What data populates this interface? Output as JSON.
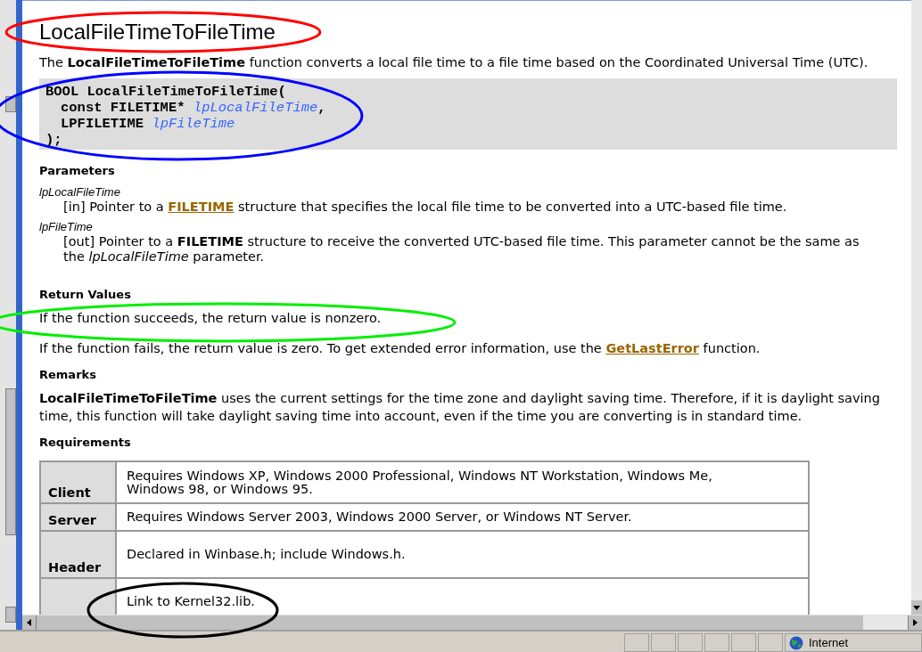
{
  "title": "LocalFileTimeToFileTime",
  "intro": "The **LocalFileTimeToFileTime** function converts a local file time to a file time based on the Coordinated Universal Time (UTC).",
  "syntax": [
    {
      "indent": false,
      "parts": [
        {
          "kind": "type",
          "text": "BOOL LocalFileTimeToFileTime("
        }
      ]
    },
    {
      "indent": true,
      "parts": [
        {
          "kind": "type",
          "text": "const FILETIME* "
        },
        {
          "kind": "param",
          "text": "lpLocalFileTime"
        },
        {
          "kind": "type",
          "text": ","
        }
      ]
    },
    {
      "indent": true,
      "parts": [
        {
          "kind": "type",
          "text": "LPFILETIME "
        },
        {
          "kind": "param",
          "text": "lpFileTime"
        }
      ]
    },
    {
      "indent": false,
      "parts": [
        {
          "kind": "type",
          "text": ");"
        }
      ]
    }
  ],
  "sections": [
    {
      "heading": "Parameters",
      "kind": "params",
      "items": [
        {
          "name": "lpLocalFileTime",
          "description": [
            {
              "kind": "text",
              "text": "[in] Pointer to a "
            },
            {
              "kind": "link",
              "text": "FILETIME"
            },
            {
              "kind": "text",
              "text": " structure that specifies the local file time to be converted into a UTC-based file time."
            }
          ]
        },
        {
          "name": "lpFileTime",
          "description": [
            {
              "kind": "text",
              "text": "[out] Pointer to a **FILETIME** structure to receive the converted UTC-based file time. This parameter cannot be the same as the *lpLocalFileTime* parameter."
            }
          ]
        }
      ]
    },
    {
      "heading": "Return Values",
      "kind": "paragraphs",
      "items": [
        [
          {
            "kind": "text",
            "text": "If the function succeeds, the return value is nonzero."
          }
        ],
        [
          {
            "kind": "text",
            "text": "If the function fails, the return value is zero. To get extended error information, use the "
          },
          {
            "kind": "link",
            "text": "GetLastError"
          },
          {
            "kind": "text",
            "text": " function."
          }
        ]
      ]
    },
    {
      "heading": "Remarks",
      "kind": "paragraphs",
      "items": [
        [
          {
            "kind": "text",
            "text": "**LocalFileTimeToFileTime** uses the current settings for the time zone and daylight saving time. Therefore, if it is daylight saving time, this function will take daylight saving time into account, even if the time you are converting is in standard time."
          }
        ]
      ]
    },
    {
      "heading": "Requirements",
      "kind": "table",
      "rows": [
        {
          "label": "Client",
          "value": "Requires Windows XP, Windows 2000 Professional, Windows NT Workstation, Windows Me, Windows 98, or Windows 95."
        },
        {
          "label": "Server",
          "value": "Requires Windows Server 2003, Windows 2000 Server, or Windows NT Server."
        },
        {
          "label": "Header",
          "value": "Declared in Winbase.h; include Windows.h."
        },
        {
          "value": "Link to Kernel32.lib."
        }
      ]
    }
  ],
  "status_bar": {
    "zone": "Internet"
  },
  "annotations": [
    {
      "color": "#ff0000"
    },
    {
      "color": "#0000ff"
    },
    {
      "color": "#00ee00"
    },
    {
      "color": "#000000"
    }
  ]
}
